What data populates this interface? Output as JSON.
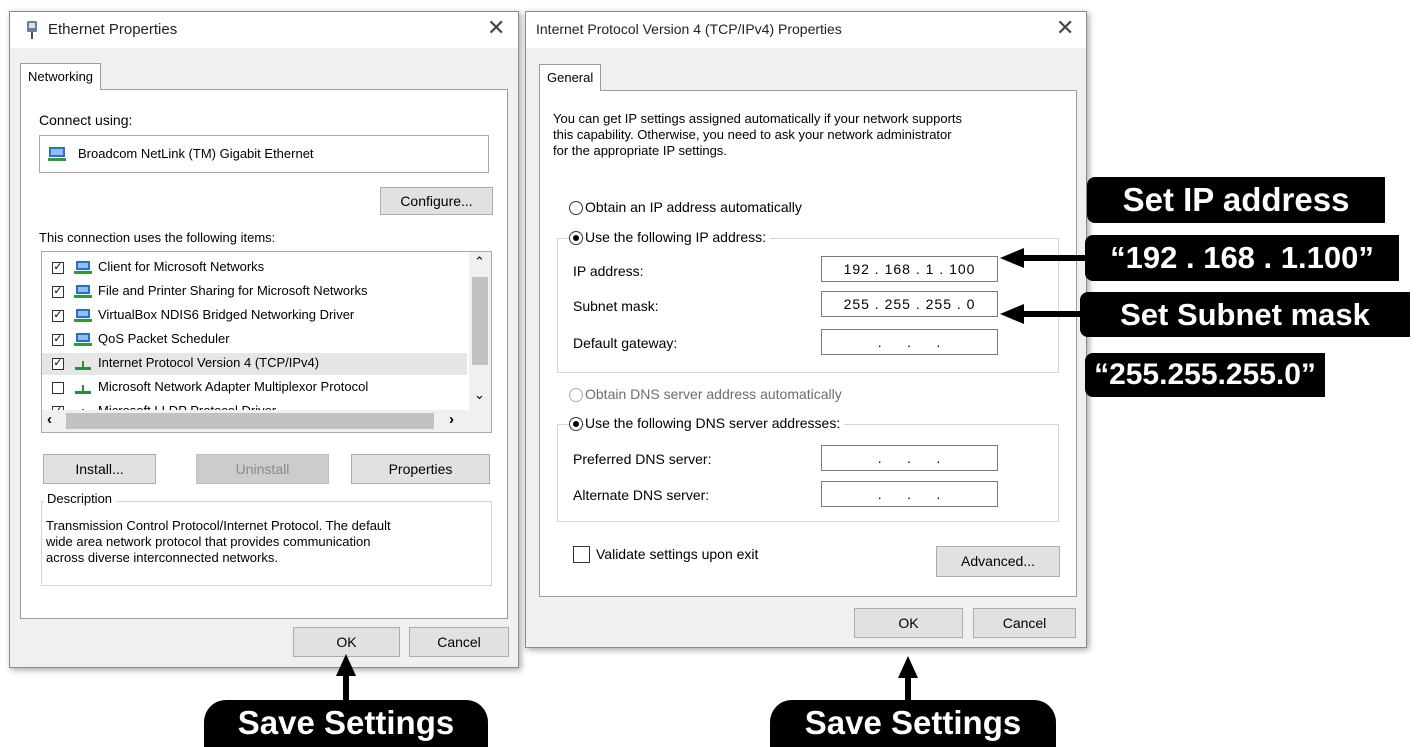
{
  "ethernet_dialog": {
    "title": "Ethernet Properties",
    "close_glyph": "✕",
    "tab": "Networking",
    "connect_using_label": "Connect using:",
    "adapter_name": "Broadcom NetLink (TM) Gigabit Ethernet",
    "configure_label": "Configure...",
    "items_label": "This connection uses the following items:",
    "items": [
      {
        "label": "Client for Microsoft Networks",
        "checked": true,
        "icon": "network-client-icon"
      },
      {
        "label": "File and Printer Sharing for Microsoft Networks",
        "checked": true,
        "icon": "network-service-icon"
      },
      {
        "label": "VirtualBox NDIS6 Bridged Networking Driver",
        "checked": true,
        "icon": "network-service-icon"
      },
      {
        "label": "QoS Packet Scheduler",
        "checked": true,
        "icon": "network-service-icon"
      },
      {
        "label": "Internet Protocol Version 4 (TCP/IPv4)",
        "checked": true,
        "icon": "protocol-icon"
      },
      {
        "label": "Microsoft Network Adapter Multiplexor Protocol",
        "checked": false,
        "icon": "protocol-icon"
      },
      {
        "label": "Microsoft LLDP Protocol Driver",
        "checked": true,
        "icon": "protocol-icon"
      }
    ],
    "install_label": "Install...",
    "uninstall_label": "Uninstall",
    "properties_label": "Properties",
    "description_label": "Description",
    "description_text_1": "Transmission Control Protocol/Internet Protocol. The default",
    "description_text_2": "wide area network protocol that provides communication",
    "description_text_3": "across diverse interconnected networks.",
    "ok_label": "OK",
    "cancel_label": "Cancel"
  },
  "ipv4_dialog": {
    "title": "Internet Protocol Version 4 (TCP/IPv4) Properties",
    "close_glyph": "✕",
    "tab": "General",
    "intro_1": "You can get IP settings assigned automatically if your network supports",
    "intro_2": "this capability. Otherwise, you need to ask your network administrator",
    "intro_3": "for the appropriate IP settings.",
    "obtain_ip_label": "Obtain an IP address automatically",
    "use_ip_label": "Use the following IP address:",
    "ip_address_label": "IP address:",
    "ip_address_value": "192 . 168 . 1 . 100",
    "subnet_label": "Subnet mask:",
    "subnet_value": "255 . 255 . 255 . 0",
    "gateway_label": "Default gateway:",
    "gateway_value": ".     .     .",
    "obtain_dns_label": "Obtain DNS server address automatically",
    "use_dns_label": "Use the following DNS server addresses:",
    "preferred_dns_label": "Preferred DNS server:",
    "preferred_dns_value": ".     .     .",
    "alternate_dns_label": "Alternate DNS server:",
    "alternate_dns_value": ".     .     .",
    "validate_label": "Validate settings upon exit",
    "advanced_label": "Advanced...",
    "ok_label": "OK",
    "cancel_label": "Cancel"
  },
  "annotations": {
    "set_ip_title": "Set IP address",
    "set_ip_value": "“192 . 168 . 1.100”",
    "set_subnet_title": "Set Subnet mask",
    "set_subnet_value": "“255.255.255.0”",
    "save_left": "Save Settings",
    "save_right": "Save Settings"
  },
  "colors": {
    "dialog_bg": "#f0f0f0",
    "callout_bg": "#000000",
    "callout_text": "#ffffff"
  }
}
